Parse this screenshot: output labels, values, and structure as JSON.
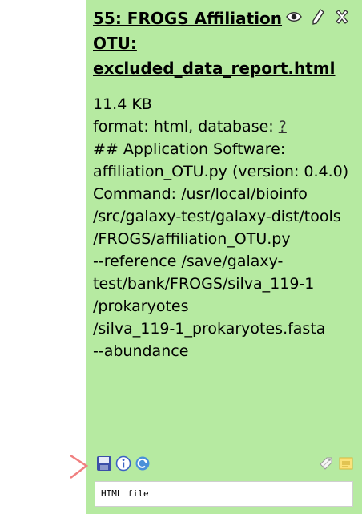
{
  "dataset": {
    "title_lines": [
      "55: FROGS Affiliation",
      "OTU:",
      "excluded_data_report.html"
    ],
    "size": "11.4 KB",
    "format_prefix": "format: html, database: ",
    "database": "?",
    "info_lines": [
      "## Application Software:",
      "affiliation_OTU.py (version: 0.4.0)",
      "Command: /usr/local/bioinfo",
      "/src/galaxy-test/galaxy-dist/tools",
      "/FROGS/affiliation_OTU.py",
      "--reference /save/galaxy-",
      "test/bank/FROGS/silva_119-1",
      "/prokaryotes",
      "/silva_119-1_prokaryotes.fasta",
      "--abundance"
    ],
    "peek": "HTML file"
  },
  "colors": {
    "panel_bg": "#b6eaa1",
    "arrow": "#f08080"
  },
  "icons": {
    "header": [
      "eye-icon",
      "pencil-icon",
      "delete-icon"
    ],
    "left": [
      "save-icon",
      "info-icon",
      "rerun-icon"
    ],
    "right": [
      "tags-icon",
      "annotation-icon"
    ]
  }
}
